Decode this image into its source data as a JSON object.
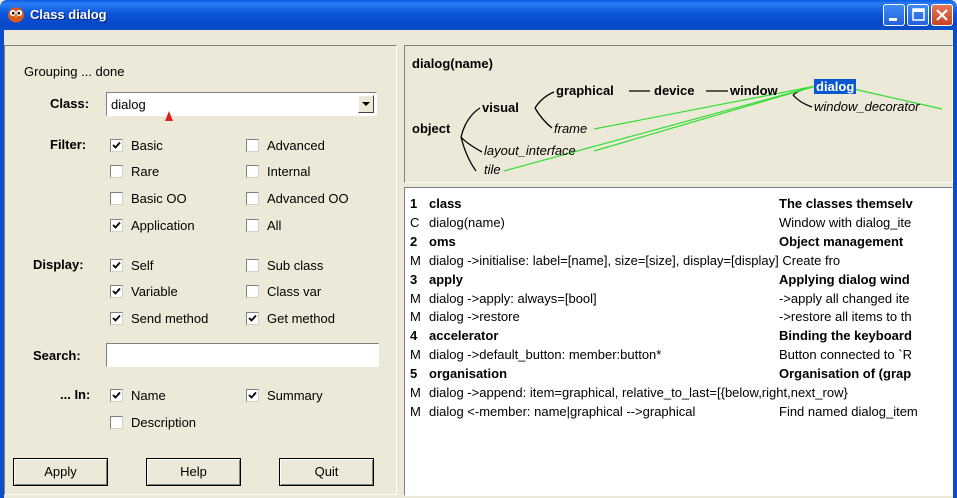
{
  "window": {
    "title": "Class dialog"
  },
  "status": "Grouping ... done",
  "class_field": {
    "label": "Class:",
    "value": "dialog"
  },
  "filter": {
    "label": "Filter:",
    "items": [
      {
        "label": "Basic",
        "checked": true
      },
      {
        "label": "Advanced",
        "checked": false
      },
      {
        "label": "Rare",
        "checked": false
      },
      {
        "label": "Internal",
        "checked": false
      },
      {
        "label": "Basic OO",
        "checked": false
      },
      {
        "label": "Advanced OO",
        "checked": false
      },
      {
        "label": "Application",
        "checked": true
      },
      {
        "label": "All",
        "checked": false
      }
    ]
  },
  "display": {
    "label": "Display:",
    "items": [
      {
        "label": "Self",
        "checked": true
      },
      {
        "label": "Sub class",
        "checked": false
      },
      {
        "label": "Variable",
        "checked": true
      },
      {
        "label": "Class var",
        "checked": false
      },
      {
        "label": "Send method",
        "checked": true
      },
      {
        "label": "Get method",
        "checked": true
      }
    ]
  },
  "search": {
    "label": "Search:",
    "value": ""
  },
  "in": {
    "label": "... In:",
    "items": [
      {
        "label": "Name",
        "checked": true
      },
      {
        "label": "Summary",
        "checked": true
      },
      {
        "label": "Description",
        "checked": false
      }
    ]
  },
  "buttons": {
    "apply": "Apply",
    "help": "Help",
    "quit": "Quit"
  },
  "graph": {
    "title": "dialog(name)",
    "nodes": {
      "object": "object",
      "visual": "visual",
      "graphical": "graphical",
      "device": "device",
      "window": "window",
      "dialog": "dialog",
      "window_decorator": "window_decorator",
      "frame": "frame",
      "layout_interface": "layout_interface",
      "tile": "tile"
    }
  },
  "members": [
    {
      "kind": "1",
      "name": "class",
      "summary": "The classes themselv",
      "heading": true
    },
    {
      "kind": "C",
      "name": "dialog(name)",
      "summary": "Window with dialog_ite",
      "heading": false
    },
    {
      "kind": "2",
      "name": "oms",
      "summary": "Object management",
      "heading": true
    },
    {
      "kind": "M",
      "name": "dialog ->initialise: label=[name], size=[size], display=[display]  Create fro",
      "summary": "",
      "heading": false
    },
    {
      "kind": "3",
      "name": "apply",
      "summary": "Applying dialog wind",
      "heading": true
    },
    {
      "kind": "M",
      "name": "dialog ->apply: always=[bool]",
      "summary": "->apply all changed ite",
      "heading": false
    },
    {
      "kind": "M",
      "name": "dialog ->restore",
      "summary": "->restore all items to th",
      "heading": false
    },
    {
      "kind": "4",
      "name": "accelerator",
      "summary": "Binding the keyboard",
      "heading": true
    },
    {
      "kind": "M",
      "name": "dialog ->default_button: member:button*",
      "summary": "Button connected to `R",
      "heading": false
    },
    {
      "kind": "5",
      "name": "organisation",
      "summary": "Organisation of (grap",
      "heading": true
    },
    {
      "kind": "M",
      "name": "dialog ->append: item=graphical, relative_to_last=[{below,right,next_row}",
      "summary": "",
      "heading": false
    },
    {
      "kind": "M",
      "name": "dialog <-member: name|graphical -->graphical",
      "summary": "Find named dialog_item",
      "heading": false
    }
  ],
  "colors": {
    "titlebar": "#0a4ec9",
    "selection": "#0a58d0",
    "link_line": "#33dd33",
    "window_bg": "#ece9d8"
  }
}
